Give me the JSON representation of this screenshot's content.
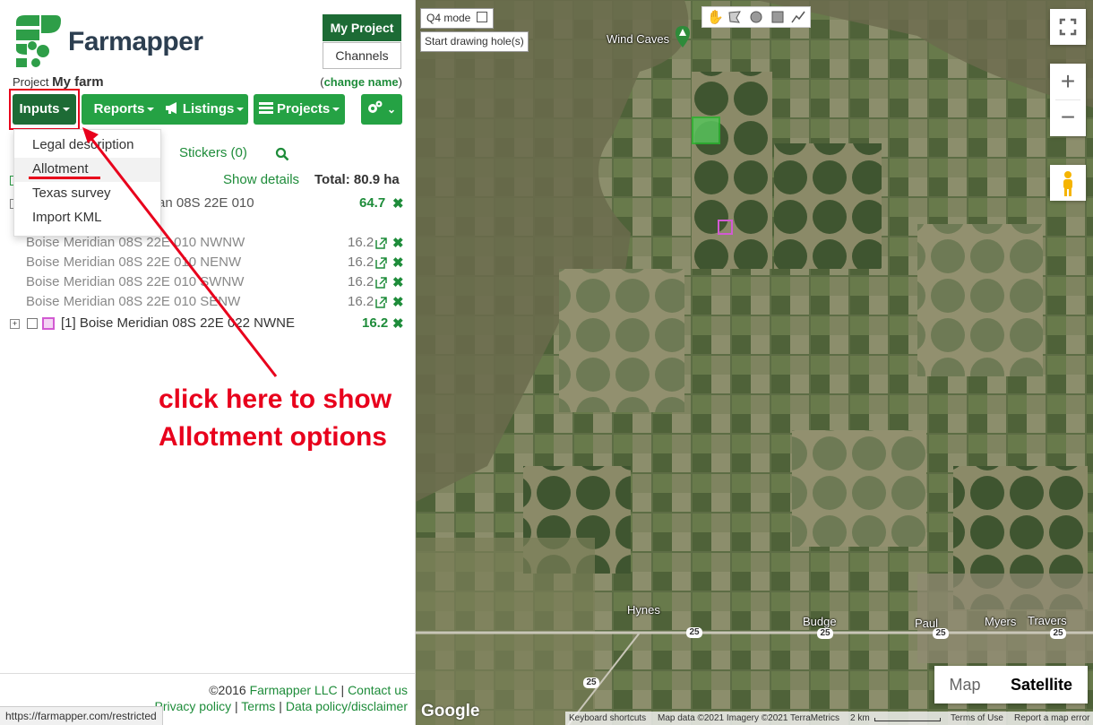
{
  "brand": {
    "name": "Farmapper"
  },
  "project": {
    "label": "Project",
    "name": "My farm",
    "change_name": "change name",
    "paren_open": "(",
    "paren_close": ")",
    "buttons": [
      "My Project",
      "Channels"
    ]
  },
  "toolbar": {
    "inputs": "Inputs",
    "reports": "Reports",
    "listings": "Listings",
    "projects": "Projects"
  },
  "dropdown": {
    "items": [
      "Legal description",
      "Allotment",
      "Texas survey",
      "Import KML"
    ]
  },
  "tabs": {
    "stickers": "Stickers",
    "stickers_count": "(0)"
  },
  "summary": {
    "show_details": "Show details",
    "total": "Total: 80.9 ha"
  },
  "parcels": {
    "parent_label_partial": "an 08S 22E 010",
    "parent_value": "64.7",
    "children": [
      {
        "name": "Boise Meridian 08S 22E 010 NWNW",
        "value": "16.2"
      },
      {
        "name": "Boise Meridian 08S 22E 010 NENW",
        "value": "16.2"
      },
      {
        "name": "Boise Meridian 08S 22E 010 SWNW",
        "value": "16.2"
      },
      {
        "name": "Boise Meridian 08S 22E 010 SENW",
        "value": "16.2"
      }
    ],
    "second": {
      "name": "[1] Boise Meridian 08S 22E 022 NWNE",
      "value": "16.2"
    }
  },
  "annotation": {
    "line1": "click here to show",
    "line2": "Allotment options"
  },
  "footer": {
    "copyright": "©2016",
    "company": "Farmapper LLC",
    "contact": "Contact us",
    "privacy": "Privacy policy",
    "terms": "Terms",
    "data_policy": "Data policy/disclaimer",
    "sep": "|"
  },
  "status_url": "https://farmapper.com/restricted",
  "map": {
    "q4_mode": "Q4 mode",
    "start_hole": "Start drawing hole(s)",
    "labels": {
      "wind_caves": "Wind Caves",
      "hynes": "Hynes",
      "budge": "Budge",
      "paul": "Paul",
      "myers": "Myers",
      "travers": "Travers"
    },
    "route": "25",
    "maptype": {
      "map": "Map",
      "satellite": "Satellite"
    },
    "attribution": {
      "shortcuts": "Keyboard shortcuts",
      "data": "Map data ©2021 Imagery ©2021 TerraMetrics",
      "scale": "2 km",
      "terms": "Terms of Use",
      "report": "Report a map error"
    },
    "google": "Google"
  },
  "colors": {
    "brand_green": "#25a244",
    "dark_green": "#1d6b35",
    "annotation_red": "#e8001c"
  }
}
